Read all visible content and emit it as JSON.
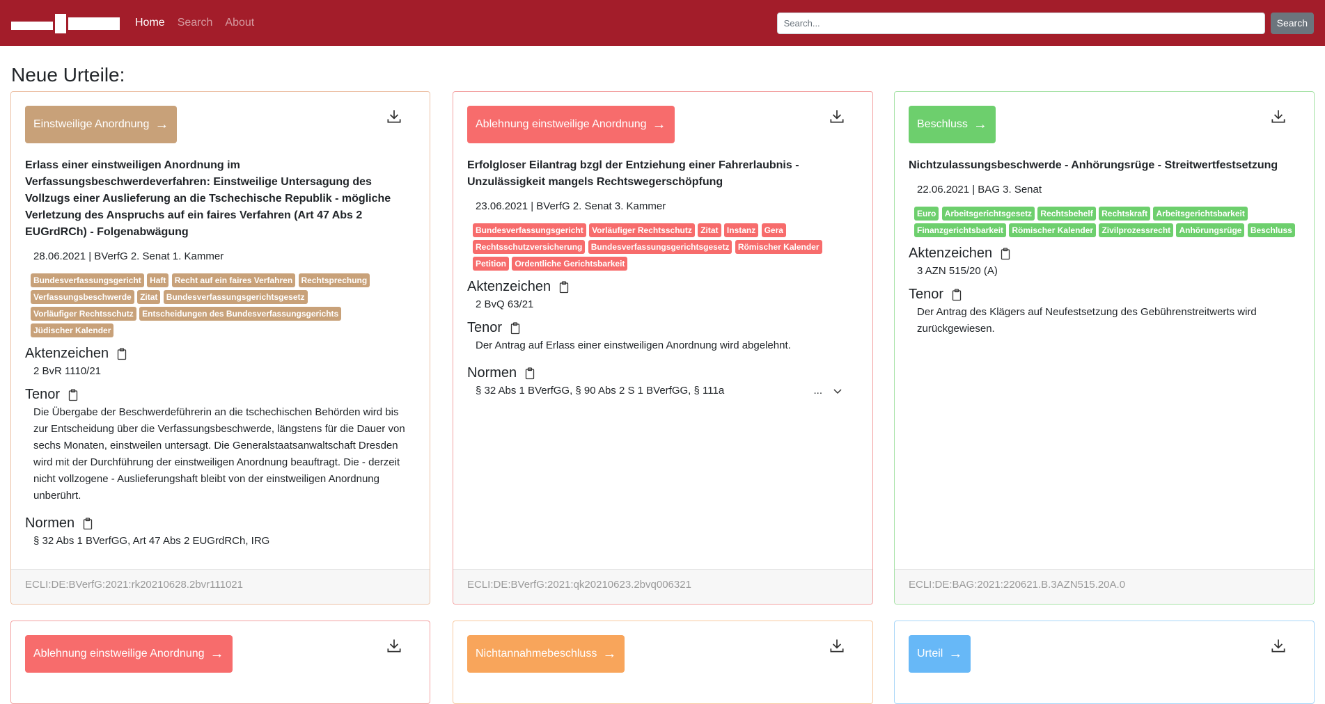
{
  "nav": {
    "home": "Home",
    "search": "Search",
    "about": "About",
    "search_placeholder": "Search...",
    "search_button": "Search"
  },
  "page_title": "Neue Urteile:",
  "labels": {
    "aktenzeichen": "Aktenzeichen",
    "tenor": "Tenor",
    "normen": "Normen"
  },
  "colors": {
    "navbar": "#a31d2a",
    "einstweilige": "#c8a179",
    "ablehnung": "#f76c6c",
    "beschluss": "#6dcf6d",
    "nichtannahme": "#f8a55b",
    "urteil": "#67b8f7"
  },
  "cards": [
    {
      "type": "Einstweilige Anordnung",
      "title": "Erlass einer einstweiligen Anordnung im Verfassungsbeschwerdeverfahren: Einstweilige Untersagung des Vollzugs einer Auslieferung an die Tschechische Republik - mögliche Verletzung des Anspruchs auf ein faires Verfahren (Art 47 Abs 2 EUGrdRCh) - Folgenabwägung",
      "meta": "28.06.2021 | BVerfG 2. Senat 1. Kammer",
      "tags": [
        "Bundesverfassungsgericht",
        "Haft",
        "Recht auf ein faires Verfahren",
        "Rechtsprechung",
        "Verfassungsbeschwerde",
        "Zitat",
        "Bundesverfassungsgerichtsgesetz",
        "Vorläufiger Rechtsschutz",
        "Entscheidungen des Bundesverfassungsgerichts",
        "Jüdischer Kalender"
      ],
      "aktenzeichen": "2 BvR 1110/21",
      "tenor": "Die Übergabe der Beschwerdeführerin an die tschechischen Behörden wird bis zur Entscheidung über die Verfassungsbeschwerde, längstens für die Dauer von sechs Monaten, einstweilen untersagt. Die Generalstaatsanwaltschaft Dresden wird mit der Durchführung der einstweiligen Anordnung beauftragt. Die - derzeit nicht vollzogene - Auslieferungshaft bleibt von der einstweiligen Anordnung unberührt.",
      "normen": "§ 32 Abs 1 BVerfGG, Art 47 Abs 2 EUGrdRCh, IRG",
      "ecli": "ECLI:DE:BVerfG:2021:rk20210628.2bvr111021"
    },
    {
      "type": "Ablehnung einstweilige Anordnung",
      "title": "Erfolgloser Eilantrag bzgl der Entziehung einer Fahrerlaubnis - Unzulässigkeit mangels Rechtswegerschöpfung",
      "meta": "23.06.2021 | BVerfG 2. Senat 3. Kammer",
      "tags": [
        "Bundesverfassungsgericht",
        "Vorläufiger Rechtsschutz",
        "Zitat",
        "Instanz",
        "Gera",
        "Rechtsschutzversicherung",
        "Bundesverfassungsgerichtsgesetz",
        "Römischer Kalender",
        "Petition",
        "Ordentliche Gerichtsbarkeit"
      ],
      "aktenzeichen": "2 BvQ 63/21",
      "tenor": "Der Antrag auf Erlass einer einstweiligen Anordnung wird abgelehnt.",
      "normen": "§ 32 Abs 1 BVerfGG, § 90 Abs 2 S 1 BVerfGG, § 111a",
      "normen_more": "...",
      "ecli": "ECLI:DE:BVerfG:2021:qk20210623.2bvq006321"
    },
    {
      "type": "Beschluss",
      "title": "Nichtzulassungsbeschwerde - Anhörungsrüge - Streitwertfestsetzung",
      "meta": "22.06.2021 | BAG 3. Senat",
      "tags": [
        "Euro",
        "Arbeitsgerichtsgesetz",
        "Rechtsbehelf",
        "Rechtskraft",
        "Arbeitsgerichtsbarkeit",
        "Finanzgerichtsbarkeit",
        "Römischer Kalender",
        "Zivilprozessrecht",
        "Anhörungsrüge",
        "Beschluss"
      ],
      "aktenzeichen": "3 AZN 515/20 (A)",
      "tenor": "Der Antrag des Klägers auf Neufestsetzung des Gebührenstreitwerts wird zurückgewiesen.",
      "ecli": "ECLI:DE:BAG:2021:220621.B.3AZN515.20A.0"
    },
    {
      "type": "Ablehnung einstweilige Anordnung"
    },
    {
      "type": "Nichtannahmebeschluss"
    },
    {
      "type": "Urteil"
    }
  ]
}
